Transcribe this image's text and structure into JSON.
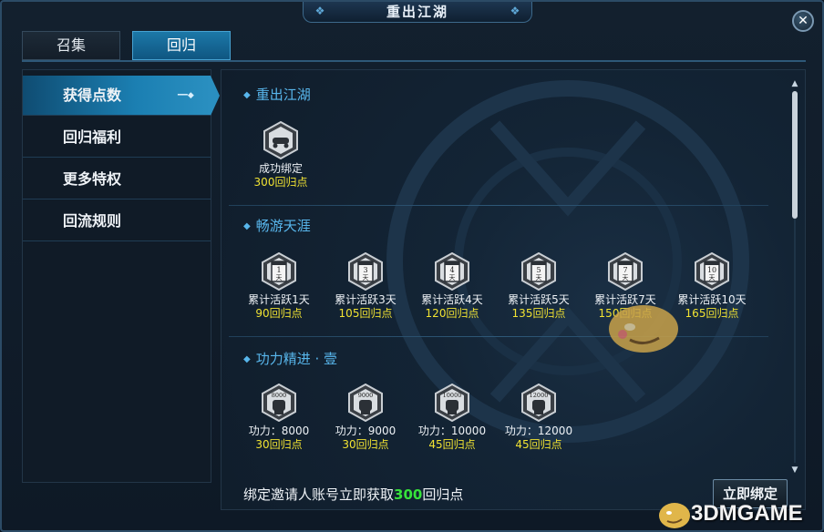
{
  "window": {
    "title": "重出江湖",
    "close_symbol": "✕"
  },
  "tabs": [
    {
      "label": "召集",
      "active": false
    },
    {
      "label": "回归",
      "active": true
    }
  ],
  "sidebar": {
    "items": [
      {
        "label": "获得点数",
        "active": true
      },
      {
        "label": "回归福利",
        "active": false
      },
      {
        "label": "更多特权",
        "active": false
      },
      {
        "label": "回流规则",
        "active": false
      }
    ]
  },
  "sections": [
    {
      "title": "重出江湖",
      "badges": [
        {
          "icon_text": "",
          "icon": "handshake-icon",
          "label": "成功绑定",
          "points": "300回归点"
        }
      ]
    },
    {
      "title": "畅游天涯",
      "badges": [
        {
          "icon_text": "1",
          "icon_text2": "天",
          "icon": "calendar-day-icon",
          "label": "累计活跃1天",
          "points": "90回归点"
        },
        {
          "icon_text": "3",
          "icon_text2": "天",
          "icon": "calendar-day-icon",
          "label": "累计活跃3天",
          "points": "105回归点"
        },
        {
          "icon_text": "4",
          "icon_text2": "天",
          "icon": "calendar-day-icon",
          "label": "累计活跃4天",
          "points": "120回归点"
        },
        {
          "icon_text": "5",
          "icon_text2": "天",
          "icon": "calendar-day-icon",
          "label": "累计活跃5天",
          "points": "135回归点"
        },
        {
          "icon_text": "7",
          "icon_text2": "天",
          "icon": "calendar-day-icon",
          "label": "累计活跃7天",
          "points": "150回归点"
        },
        {
          "icon_text": "10",
          "icon_text2": "天",
          "icon": "calendar-day-icon",
          "label": "累计活跃10天",
          "points": "165回归点"
        }
      ]
    },
    {
      "title": "功力精进 · 壹",
      "badges": [
        {
          "icon_text": "8000",
          "icon": "fist-power-icon",
          "label": "功力：8000",
          "points": "30回归点"
        },
        {
          "icon_text": "9000",
          "icon": "fist-power-icon",
          "label": "功力：9000",
          "points": "30回归点"
        },
        {
          "icon_text": "10000",
          "icon": "fist-power-icon",
          "label": "功力：10000",
          "points": "45回归点"
        },
        {
          "icon_text": "12000",
          "icon": "fist-power-icon",
          "label": "功力：12000",
          "points": "45回归点"
        }
      ]
    }
  ],
  "footer": {
    "text_before": "绑定邀请人账号立即获取",
    "highlight": "300",
    "text_after": "回归点",
    "button_label": "立即绑定"
  },
  "watermark": {
    "text": "3DMGAME"
  },
  "colors": {
    "accent_blue": "#58b6ec",
    "points_yellow": "#f0e232",
    "highlight_green": "#36e23a",
    "active_tab": "#1c78a8"
  }
}
